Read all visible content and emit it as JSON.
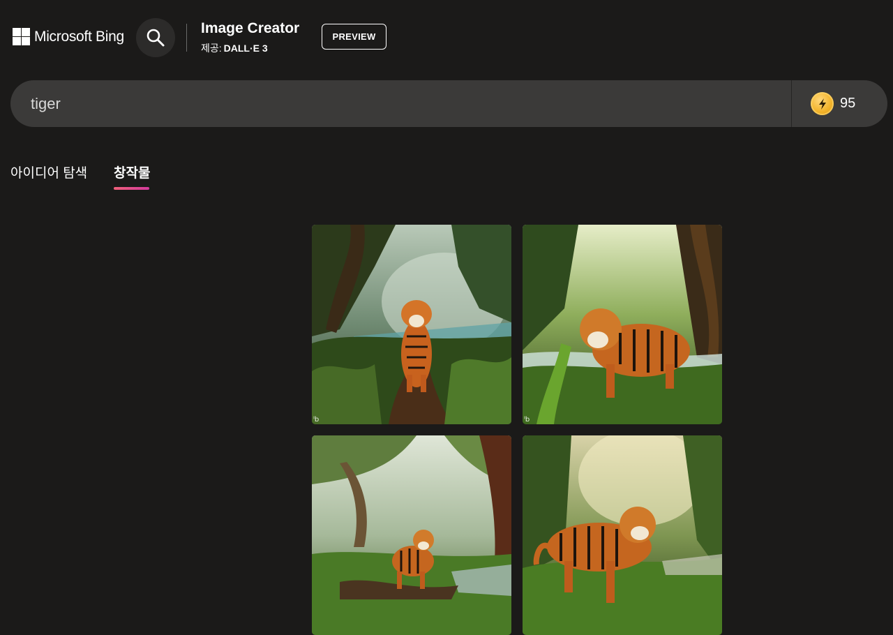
{
  "header": {
    "brand": "Microsoft Bing",
    "app_title": "Image Creator",
    "powered_by_label": "제공:",
    "powered_by_model": "DALL·E 3",
    "preview_label": "PREVIEW"
  },
  "search": {
    "value": "tiger",
    "search_icon": "search-icon"
  },
  "boosts": {
    "count": "95",
    "icon": "boost-coin-icon",
    "color": "#f3b42c"
  },
  "tabs": [
    {
      "label": "아이디어 탐색",
      "active": false
    },
    {
      "label": "창작물",
      "active": true
    }
  ],
  "images": [
    {
      "alt": "tiger walking on a jungle path by a river"
    },
    {
      "alt": "tiger standing in sunlit jungle"
    },
    {
      "alt": "tiger crossing a forest stream"
    },
    {
      "alt": "tiger prowling through misty jungle"
    }
  ],
  "colors": {
    "background": "#1b1a19",
    "searchbar": "#3b3a39",
    "tab_accent_start": "#f0607a",
    "tab_accent_end": "#d33a9c"
  }
}
